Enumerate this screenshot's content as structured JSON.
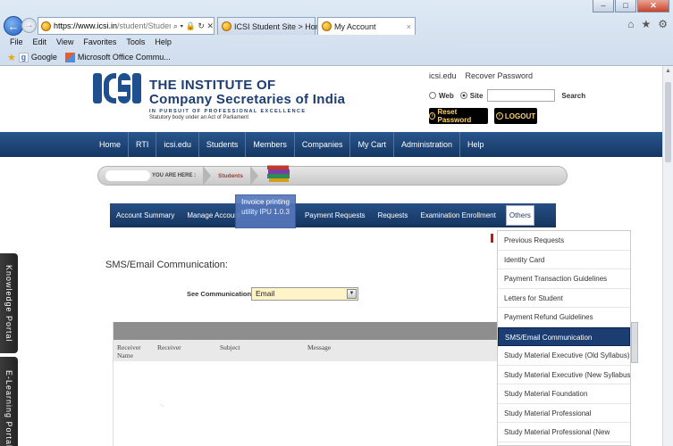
{
  "browser": {
    "address_url_main": "https://www.icsi.in",
    "address_url_rest": "/student/Students/MyAccou",
    "address_icons": "⌕ ▾ 🔒 ↻ ✕",
    "tabs": [
      {
        "label": "ICSI Student Site > Home"
      },
      {
        "label": "My Account"
      }
    ],
    "tab_close": "×",
    "menu": [
      "File",
      "Edit",
      "View",
      "Favorites",
      "Tools",
      "Help"
    ],
    "favorites": [
      "Google",
      "Microsoft Office Commu..."
    ],
    "win_min": "–",
    "win_max": "□",
    "win_close": "✕"
  },
  "header": {
    "line1": "THE INSTITUTE OF",
    "line2": "Company Secretaries of India",
    "tagline": "IN PURSUIT OF PROFESSIONAL EXCELLENCE",
    "statutory": "Statutory body under an Act of Parliament",
    "toplinks": [
      "icsi.edu",
      "Recover Password"
    ],
    "radio_web": "Web",
    "radio_site": "Site",
    "search_label": "Search",
    "reset_label": "Reset Password",
    "logout_label": "LOGOUT"
  },
  "mainnav": [
    "Home",
    "RTI",
    "icsi.edu",
    "Students",
    "Members",
    "Companies",
    "My Cart",
    "Administration",
    "Help"
  ],
  "breadcrumb": {
    "you_are_here": "YOU ARE HERE :",
    "current": "Students"
  },
  "subnav": [
    "Account Summary",
    "Manage Account",
    "Payment Requests",
    "Requests",
    "Examination Enrollment"
  ],
  "subnav_others": "Others",
  "invoice_tip": "Invoice printing utility IPU 1.0.3",
  "main": {
    "title": "SMS/Email Communication:",
    "see_label": "See Communication",
    "select_value": "Email",
    "table_cols": [
      "Receiver Name",
      "Receiver",
      "Subject",
      "Message"
    ],
    "dot": "·."
  },
  "dropdown": [
    "Previous Requests",
    "Identity Card",
    "Payment Transaction Guidelines",
    "Letters for Student",
    "Payment Refund Guidelines",
    "SMS/Email Communication",
    "Study Material Executive (Old Syllabus)",
    "Study Material Executive (New Syllabus)",
    "Study Material Foundation",
    "Study Material Professional",
    "Study Material Professional (New"
  ],
  "dropdown_active_index": 5,
  "side_tabs": [
    "Knowledge Portal",
    "E-Learning Portal"
  ],
  "colors": {
    "nav_blue": "#1e4270",
    "brand_blue": "#1e3d73",
    "button_text": "#ffd56b",
    "highlight": "#1b3d72"
  }
}
